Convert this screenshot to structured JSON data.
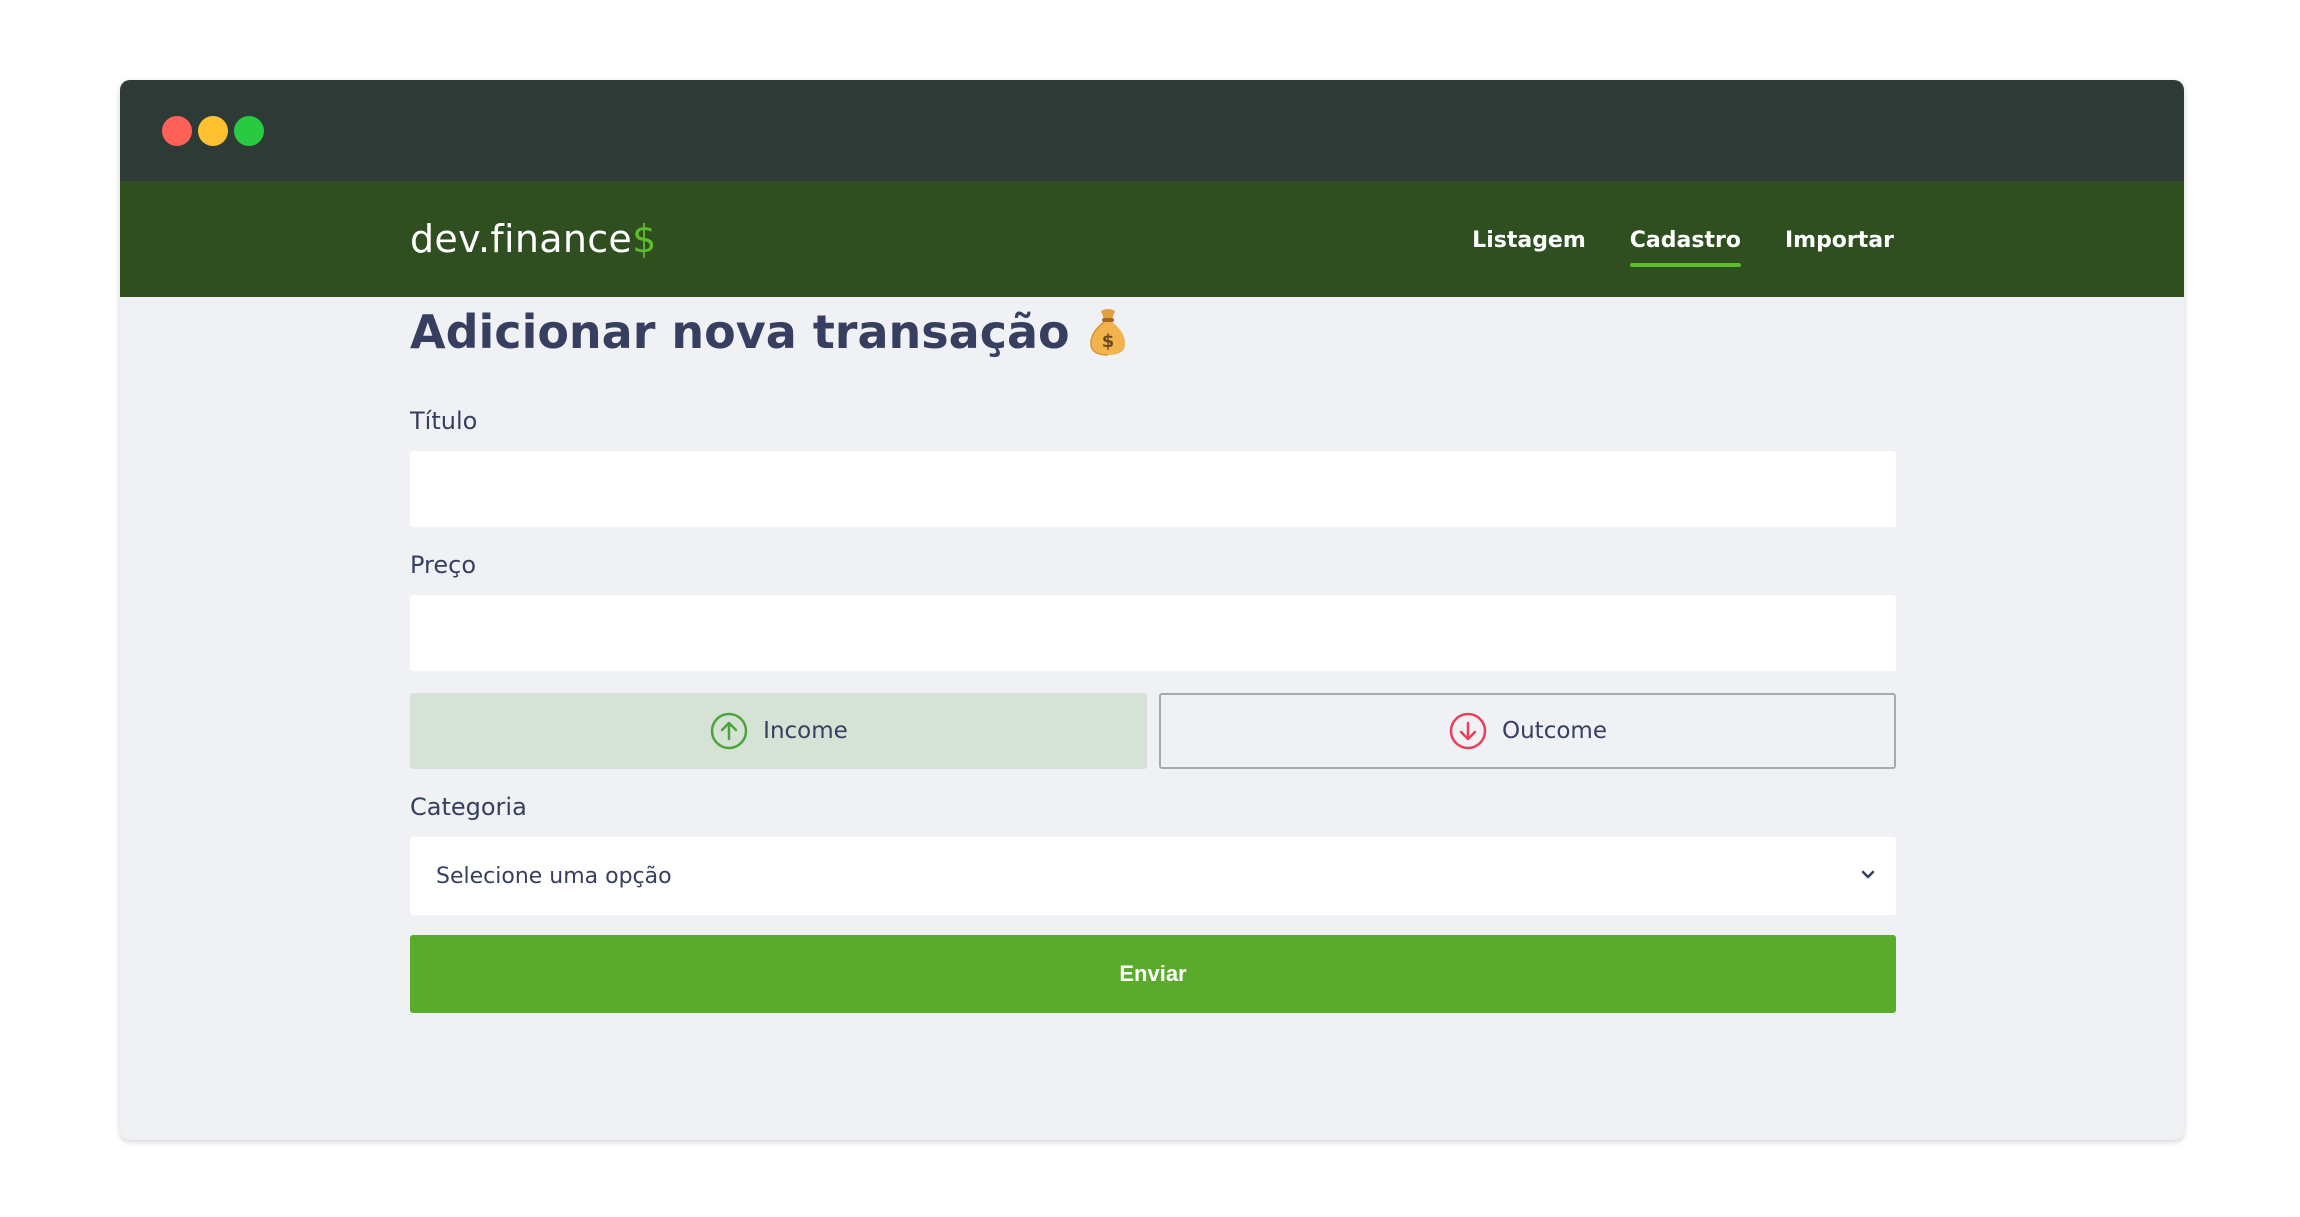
{
  "app": {
    "logo_main": "dev.finance",
    "logo_accent": "$"
  },
  "nav": {
    "items": [
      {
        "label": "Listagem",
        "active": false
      },
      {
        "label": "Cadastro",
        "active": true
      },
      {
        "label": "Importar",
        "active": false
      }
    ]
  },
  "form": {
    "title": "Adicionar nova transação",
    "title_icon": "money-bag-icon",
    "titulo_label": "Título",
    "titulo_value": "",
    "preco_label": "Preço",
    "preco_value": "",
    "income_label": "Income",
    "outcome_label": "Outcome",
    "income_selected": true,
    "categoria_label": "Categoria",
    "categoria_selected": "Selecione uma opção",
    "submit_label": "Enviar"
  },
  "colors": {
    "titlebar": "#2e3a36",
    "header": "#2f4f20",
    "accent": "#5cbc2e",
    "income": "#4aa63a",
    "outcome": "#e83f5b",
    "submit": "#5aaa2b",
    "text": "#363f5f"
  }
}
